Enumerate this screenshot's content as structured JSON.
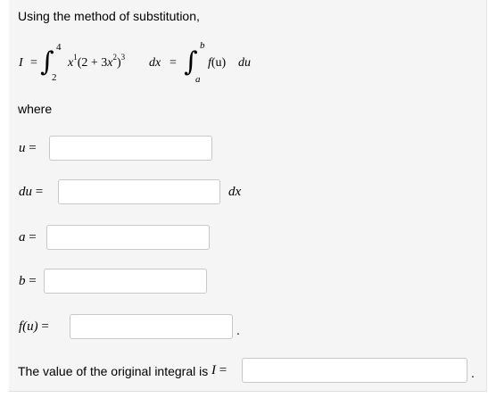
{
  "intro": "Using the method of substitution,",
  "equation": {
    "lhs": "I",
    "eq": "=",
    "lower_limit_1": "2",
    "upper_limit_1": "4",
    "integrand_x": "x",
    "integrand_x_exp": "1",
    "integrand_paren": "(2 + 3",
    "integrand_x2": "x",
    "integrand_x2_exp": "2",
    "integrand_close": ")",
    "integrand_close_exp": "3",
    "integrand_dx": "dx",
    "eq2": "=",
    "upper_limit_2": "b",
    "lower_limit_2": "a",
    "rhs_f": "f",
    "rhs_u": "(u)",
    "rhs_du": "du"
  },
  "where_label": "where",
  "fields": {
    "u": {
      "label_var": "u",
      "label_eq": "=",
      "value": ""
    },
    "du": {
      "label_var": "du",
      "label_eq": "=",
      "value": "",
      "suffix": "dx"
    },
    "a": {
      "label_var": "a",
      "label_eq": "=",
      "value": ""
    },
    "b": {
      "label_var": "b",
      "label_eq": "=",
      "value": ""
    },
    "fu": {
      "label_var": "f(u)",
      "label_eq": "=",
      "value": "",
      "suffix": "."
    }
  },
  "final": {
    "text": "The value of the original integral is",
    "var": "I",
    "eq": "=",
    "value": "",
    "suffix": "."
  }
}
